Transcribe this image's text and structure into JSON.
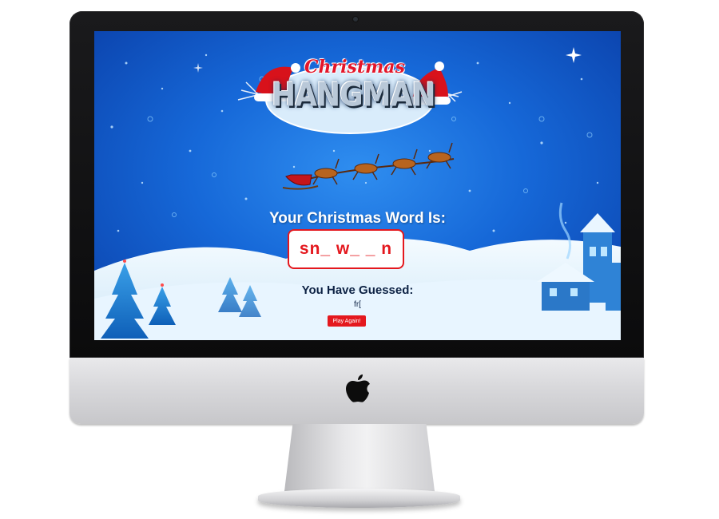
{
  "game": {
    "logo_script": "Christmas",
    "logo_main": "HANGMAN",
    "word_title": "Your Christmas Word Is:",
    "word_display": "sn_ w_ _ n",
    "guessed_title": "You Have Guessed:",
    "guessed_letters": "fr[",
    "play_again_label": "Play Again!"
  },
  "colors": {
    "accent_red": "#e4181e",
    "sky_blue": "#1668d8",
    "guess_text": "#0d2244"
  },
  "icons": {
    "monitor_logo": "apple-icon",
    "camera": "camera-icon"
  }
}
